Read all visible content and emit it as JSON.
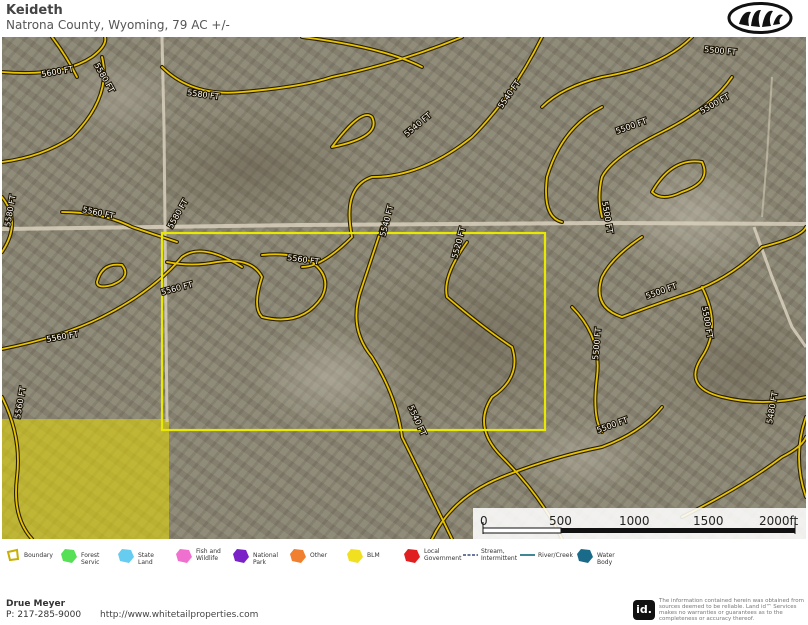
{
  "header": {
    "title": "Keideth",
    "subtitle": "Natrona County, Wyoming, 79 AC +/-"
  },
  "map": {
    "contour_color": "#e8c400",
    "boundary_color": "#e8e800",
    "blm_color": "#e8d800",
    "contour_labels": [
      {
        "text": "5600 FT"
      },
      {
        "text": "5580 FT"
      },
      {
        "text": "5580 FT"
      },
      {
        "text": "5540 FT"
      },
      {
        "text": "5540 FT"
      },
      {
        "text": "5500 FT"
      },
      {
        "text": "5500 FT"
      },
      {
        "text": "5500 FT"
      },
      {
        "text": "5560 FT"
      },
      {
        "text": "5580 FT"
      },
      {
        "text": "5580 FT"
      },
      {
        "text": "5560 FT"
      },
      {
        "text": "5560 FT"
      },
      {
        "text": "5540 FT"
      },
      {
        "text": "5520 FT"
      },
      {
        "text": "5500 FT"
      },
      {
        "text": "5500 FT"
      },
      {
        "text": "5500 FT"
      },
      {
        "text": "5540 FT"
      },
      {
        "text": "5560 FT"
      },
      {
        "text": "5560 FT"
      },
      {
        "text": "5500 FT"
      },
      {
        "text": "5500 FT"
      },
      {
        "text": "5480 FT"
      }
    ]
  },
  "scale": {
    "ticks": [
      "0",
      "500",
      "1000",
      "1500",
      "2000ft"
    ]
  },
  "legend": [
    {
      "label": "Boundary",
      "color": "#e8e800",
      "icon": "boundary-icon"
    },
    {
      "label": "Forest Servic",
      "color": "#55e055",
      "icon": "forest-service-icon"
    },
    {
      "label": "State Land",
      "color": "#66ccf0",
      "icon": "state-land-icon"
    },
    {
      "label": "Fish and Wildlife",
      "color": "#f070d0",
      "icon": "fish-wildlife-icon"
    },
    {
      "label": "National Park",
      "color": "#7a22c8",
      "icon": "national-park-icon"
    },
    {
      "label": "Other",
      "color": "#f08030",
      "icon": "other-icon"
    },
    {
      "label": "BLM",
      "color": "#f0e020",
      "icon": "blm-icon"
    },
    {
      "label": "Local Government",
      "color": "#e02020",
      "icon": "local-government-icon"
    },
    {
      "label": "Stream, Intermittent",
      "color": "#3a4a7a",
      "icon": "stream-intermittent-icon"
    },
    {
      "label": "River/Creek",
      "color": "#2a7a8a",
      "icon": "river-creek-icon"
    },
    {
      "label": "Water Body",
      "color": "#1a6a8a",
      "icon": "water-body-icon"
    }
  ],
  "footer": {
    "name": "Drue Meyer",
    "phone": "P: 217-285-9000",
    "url": "http://www.whitetailproperties.com",
    "badge": "id.",
    "disclaimer": "The information contained herein was obtained from sources deemed to be reliable. Land id™ Services makes no warranties or guarantees as to the completeness or accuracy thereof."
  }
}
